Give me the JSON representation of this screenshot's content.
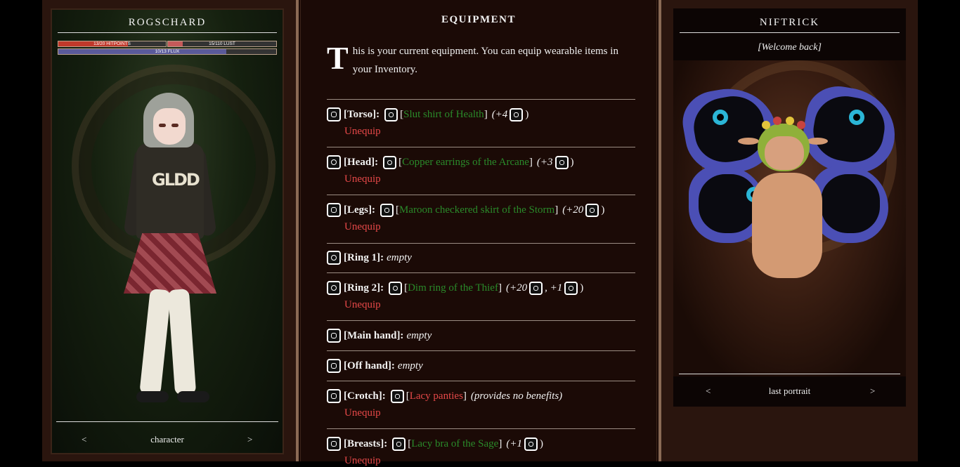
{
  "character_panel": {
    "title": "ROGSCHARD",
    "stats": [
      {
        "label": "13/20 HITPOINTS",
        "fraction": 0.65,
        "color": "#c0392b"
      },
      {
        "label": "15/110 LUST",
        "fraction": 0.136,
        "color": "#c45a5a"
      },
      {
        "label": "10/13 FLUX",
        "fraction": 0.77,
        "color": "#5a5a9a"
      }
    ],
    "nav": {
      "prev": "<",
      "label": "character",
      "next": ">"
    }
  },
  "equipment": {
    "heading": "EQUIPMENT",
    "intro_dropcap": "T",
    "intro_text": "his is your current equipment. You can equip wearable items in your Inventory.",
    "unequip_label": "Unequip",
    "slots": [
      {
        "slot": "[Torso]:",
        "icon": "torso-icon",
        "item_icon": "shirt-icon",
        "open": "[",
        "item": "Slut shirt of Health",
        "close": "]",
        "bonus": "(+4",
        "bonus_icon": "health-icon",
        "bonus_end": ")"
      },
      {
        "slot": "[Head]:",
        "icon": "headphones-icon",
        "item_icon": "earring-icon",
        "open": "[",
        "item": "Copper earrings of the Arcane",
        "close": "]",
        "bonus": "(+3",
        "bonus_icon": "arcane-icon",
        "bonus_end": ")"
      },
      {
        "slot": "[Legs]:",
        "icon": "legs-icon",
        "item_icon": "skirt-icon",
        "open": "[",
        "item": "Maroon checkered skirt of the Storm",
        "close": "]",
        "bonus": "(+20",
        "bonus_icon": "lightning-icon",
        "bonus_end": ")"
      },
      {
        "slot": "[Ring 1]:",
        "icon": "ring-icon",
        "empty": "empty"
      },
      {
        "slot": "[Ring 2]:",
        "icon": "ring-icon",
        "item_icon": "ring-item-icon",
        "open": "[",
        "item": "Dim ring of the Thief",
        "close": "]",
        "bonus": "(+20",
        "bonus_icon": "thief-icon",
        "bonus_mid": ", +1",
        "bonus_icon2": "crossed-swords-icon",
        "bonus_end": ")"
      },
      {
        "slot": "[Main hand]:",
        "icon": "hand-icon",
        "empty": "empty"
      },
      {
        "slot": "[Off hand]:",
        "icon": "shield-icon",
        "empty": "empty"
      },
      {
        "slot": "[Crotch]:",
        "icon": "feather-icon",
        "item_icon": "panties-icon",
        "open": "[",
        "item": "Lacy panties",
        "close": "]",
        "bonus": "(provides no benefits)"
      },
      {
        "slot": "[Breasts]:",
        "icon": "bra-icon",
        "item_icon": "bra-item-icon",
        "open": "[",
        "item": "Lacy bra of the Sage",
        "close": "]",
        "bonus": "(+1",
        "bonus_icon": "sage-icon",
        "bonus_end": ")"
      }
    ]
  },
  "portrait_panel": {
    "title": "NIFTRICK",
    "welcome": "[Welcome back]",
    "nav": {
      "prev": "<",
      "label": "last portrait",
      "next": ">"
    }
  },
  "colors": {
    "item_green": "#2a8a2a",
    "unequip_red": "#e54848",
    "frame_brown": "#2a150e"
  }
}
